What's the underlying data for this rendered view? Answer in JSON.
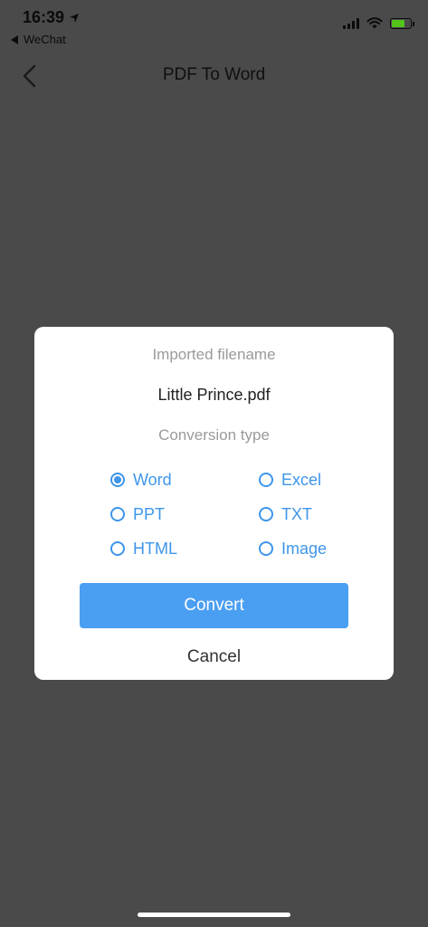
{
  "status_bar": {
    "time": "16:39",
    "back_app": "WeChat",
    "battery_color": "#52c41a"
  },
  "nav": {
    "back_icon": "chevron-left-icon",
    "title": "PDF To Word"
  },
  "dialog": {
    "filename_label": "Imported filename",
    "filename": "Little Prince.pdf",
    "conversion_label": "Conversion type",
    "options": [
      {
        "label": "Word",
        "selected": true
      },
      {
        "label": "Excel",
        "selected": false
      },
      {
        "label": "PPT",
        "selected": false
      },
      {
        "label": "TXT",
        "selected": false
      },
      {
        "label": "HTML",
        "selected": false
      },
      {
        "label": "Image",
        "selected": false
      }
    ],
    "convert_label": "Convert",
    "cancel_label": "Cancel"
  },
  "colors": {
    "overlay": "#4a4a4a",
    "accent": "#3e95ea",
    "button": "#4b9ff2"
  }
}
